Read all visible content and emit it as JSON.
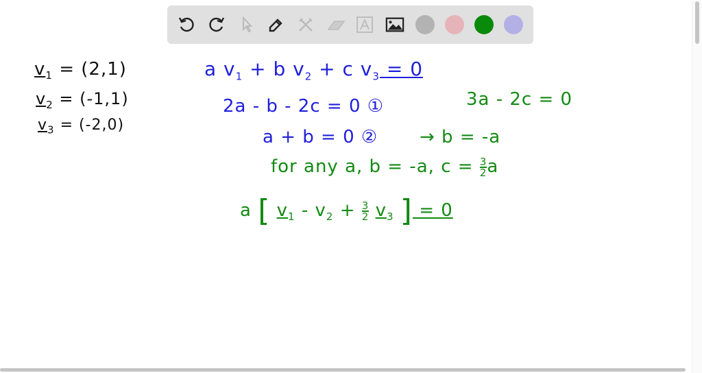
{
  "toolbar": {
    "tools": [
      "undo-icon",
      "redo-icon",
      "pointer-icon",
      "pen-icon",
      "tools-icon",
      "eraser-icon",
      "text-icon",
      "image-icon"
    ],
    "colors": [
      "#b3b3b3",
      "#e6b3b8",
      "#0a8a0a",
      "#b3b0e6"
    ],
    "selected_color": "#0a8a0a"
  },
  "board": {
    "v1": {
      "name": "v",
      "sub": "1",
      "rhs": "= (2,1)"
    },
    "v2": {
      "name": "v",
      "sub": "2",
      "rhs": "= (-1,1)"
    },
    "v3": {
      "name": "v",
      "sub": "3",
      "rhs": "= (-2,0)"
    },
    "eq_main": {
      "a": "a v",
      "s1": "1",
      "b": " + b v",
      "s2": "2",
      "c": " + c v",
      "s3": "3",
      "rhs": " = 0"
    },
    "eq1": "2a - b - 2c = 0  ①",
    "eq2": "a + b   = 0  ②",
    "eq2_result": "→  b = -a",
    "eq3": "3a - 2c = 0",
    "general": {
      "text": "for any a,  b = -a,   c = ",
      "num": "3",
      "den": "2",
      "tail": "a"
    },
    "final": {
      "a": "a",
      "lb": "[",
      "v1": "v",
      "s1": "1",
      "m": " - v",
      "s2": "2",
      "p": " + ",
      "num": "3",
      "den": "2",
      "v3": "v",
      "s3": "3",
      "rb": "]",
      "rhs": " = 0"
    }
  }
}
